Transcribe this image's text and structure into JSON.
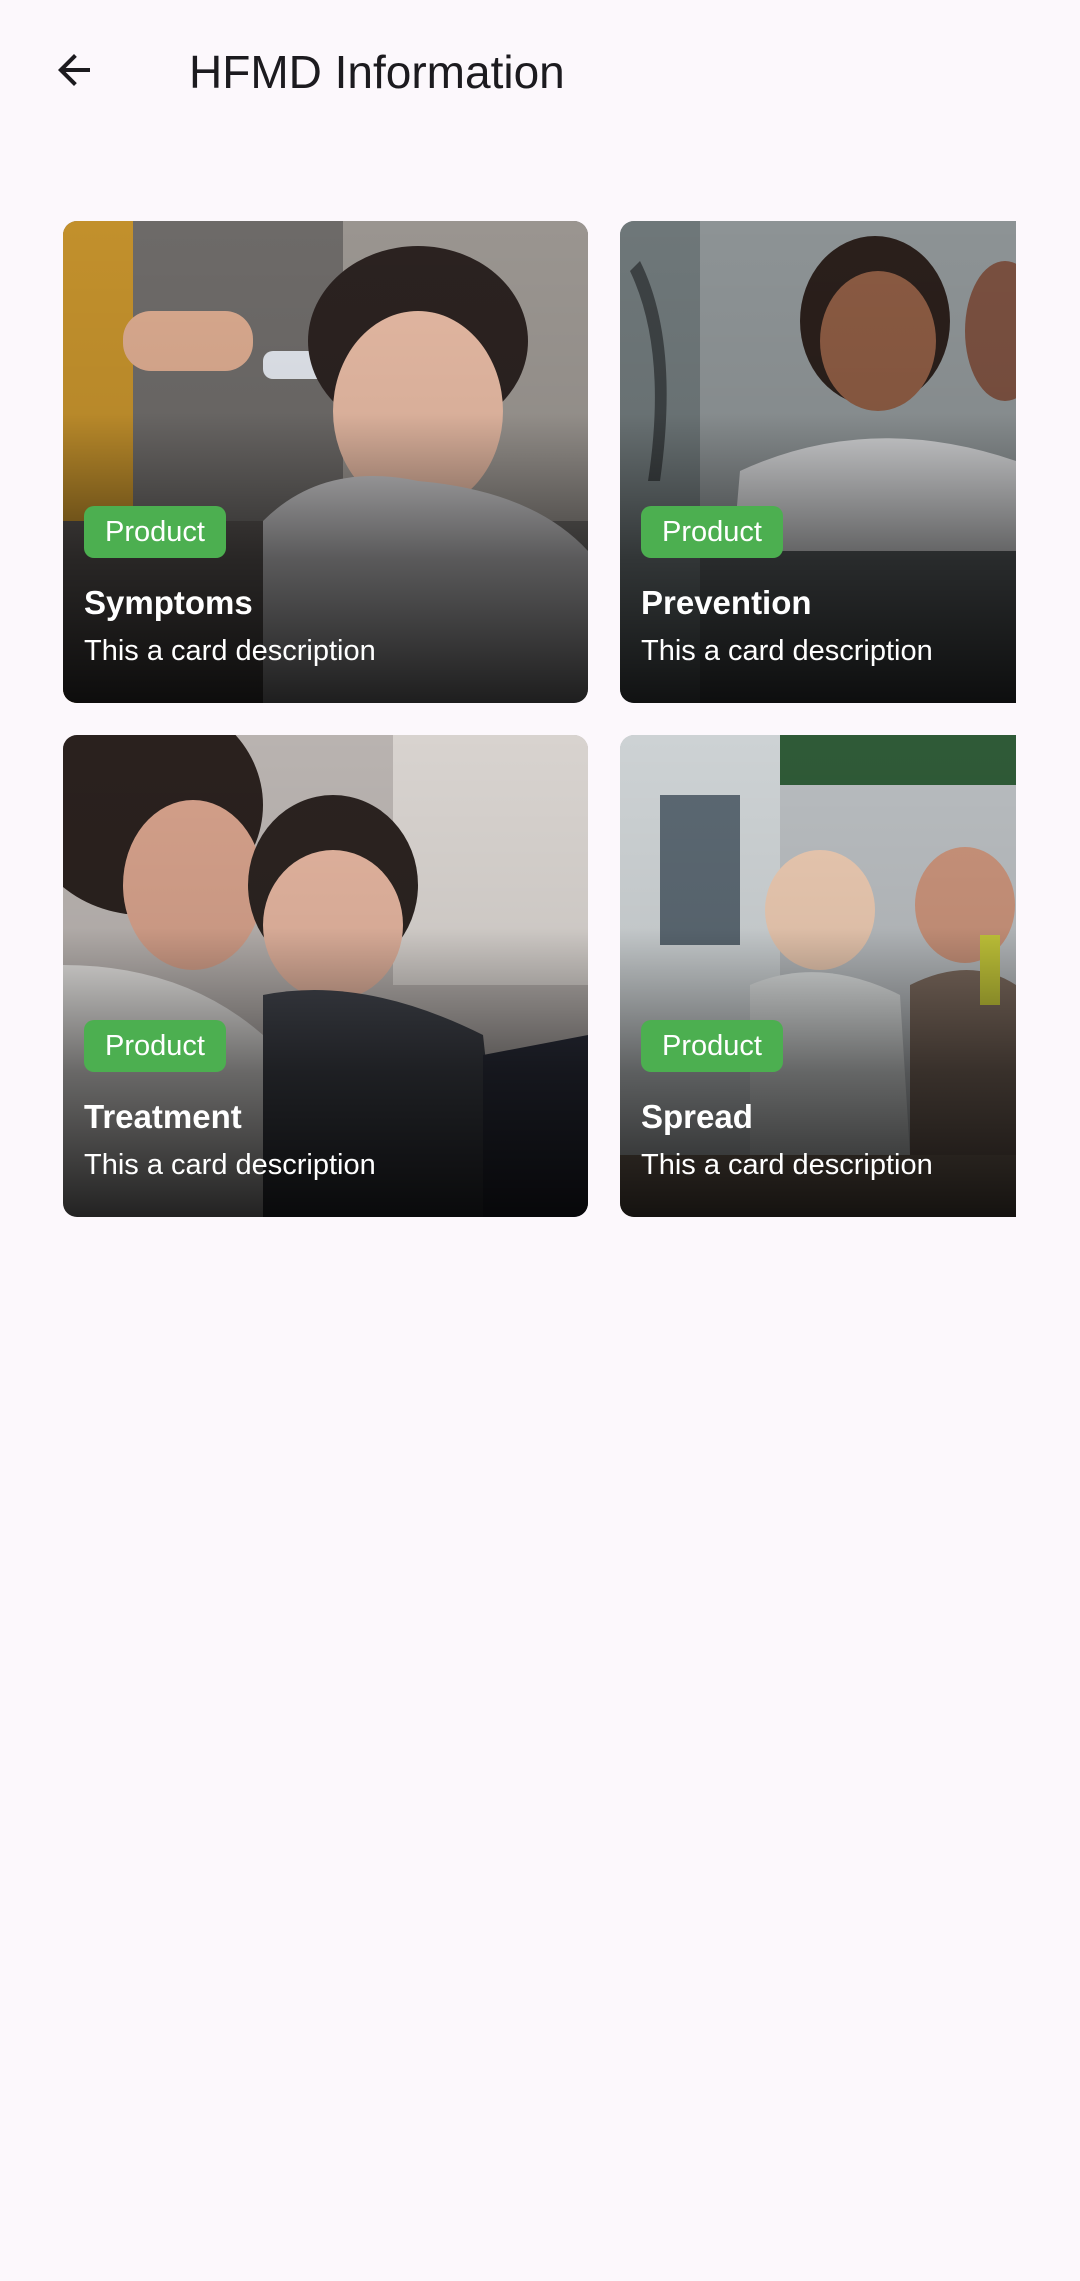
{
  "app_bar": {
    "title": "HFMD Information",
    "back_icon": "arrow-back-icon"
  },
  "cards": [
    {
      "badge": "Product",
      "title": "Symptoms",
      "description": "This a card description",
      "image": "child-temperature-check-photo"
    },
    {
      "badge": "Product",
      "title": "Prevention",
      "description": "This a card description",
      "image": "mother-washing-hands-with-child-photo"
    },
    {
      "badge": "Product",
      "title": "Treatment",
      "description": "This a card description",
      "image": "mother-comforting-crying-child-photo"
    },
    {
      "badge": "Product",
      "title": "Spread",
      "description": "This a card description",
      "image": "babies-playing-with-toys-photo"
    }
  ],
  "colors": {
    "background": "#fcf8fc",
    "badge": "#4caf50",
    "title_text": "#1c1b1f",
    "card_text": "#ffffff"
  }
}
